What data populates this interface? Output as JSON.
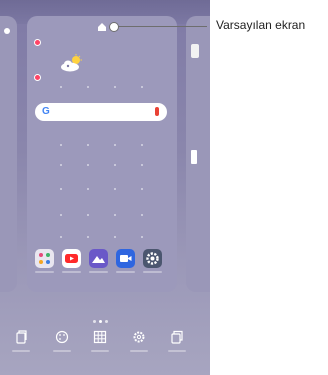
{
  "callout": {
    "label": "Varsayılan ekran"
  },
  "icons": {
    "home": "home-icon",
    "weather": "weather-icon",
    "search_logo": "google-g-icon",
    "mic": "mic-icon"
  },
  "dock_apps": [
    {
      "name": "gallery-app-icon",
      "color": "#e9e6f0"
    },
    {
      "name": "youtube-app-icon",
      "color": "#ff2a2a"
    },
    {
      "name": "photo-app-icon",
      "color": "#6a58c8"
    },
    {
      "name": "video-app-icon",
      "color": "#2f66e0"
    },
    {
      "name": "settings-app-icon",
      "color": "#4b566f"
    }
  ],
  "bottom_tools": [
    "page-icon",
    "palette-icon",
    "grid-icon",
    "settings-icon",
    "copy-icon"
  ],
  "search": {
    "g": "G"
  },
  "colors": {
    "accent": "#4285f4",
    "badge_red": "#ff4466"
  }
}
